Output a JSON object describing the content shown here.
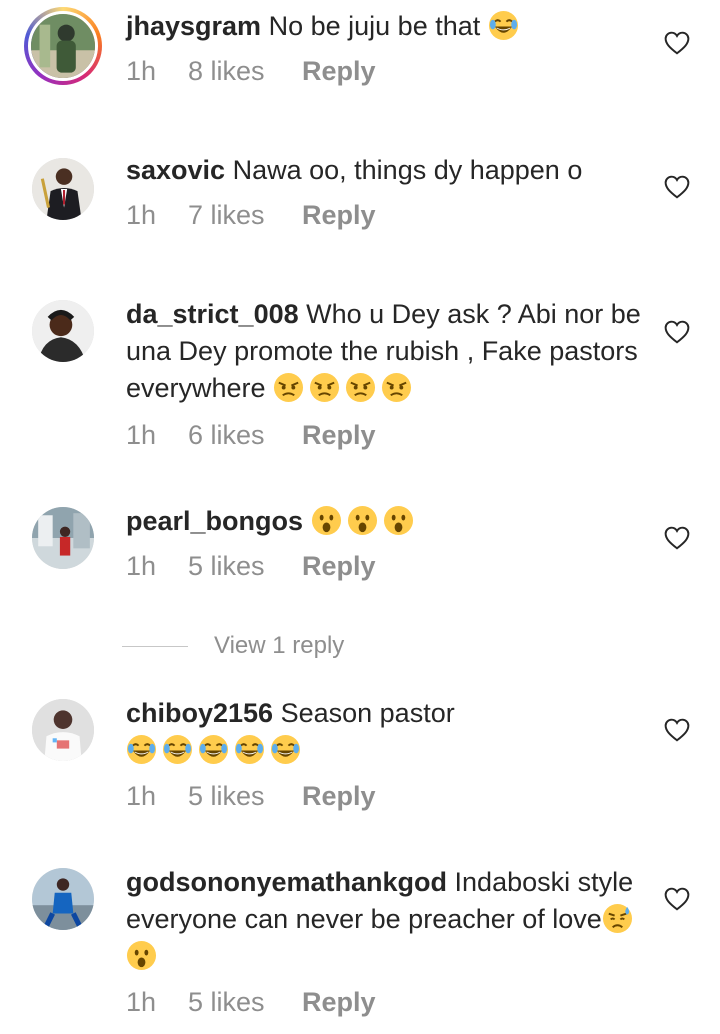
{
  "comments": [
    {
      "username": "jhaysgram",
      "text": "No be juju be that",
      "emojis": [
        "laughing"
      ],
      "time": "1h",
      "likes": "8 likes",
      "reply": "Reply",
      "avatar": "avatar-jhaysgram"
    },
    {
      "username": "saxovic",
      "text": "Nawa oo, things dy happen o",
      "emojis": [],
      "time": "1h",
      "likes": "7 likes",
      "reply": "Reply",
      "avatar": "avatar-saxovic"
    },
    {
      "username": "da_strict_008",
      "text": "Who u Dey ask ? Abi nor be una Dey promote the rubish , Fake pastors everywhere",
      "emojis": [
        "angry",
        "angry",
        "angry",
        "angry"
      ],
      "time": "1h",
      "likes": "6 likes",
      "reply": "Reply",
      "avatar": "avatar-da-strict"
    },
    {
      "username": "pearl_bongos",
      "text": "",
      "emojis": [
        "astonished",
        "astonished",
        "astonished"
      ],
      "time": "1h",
      "likes": "5 likes",
      "reply": "Reply",
      "avatar": "avatar-pearl"
    },
    {
      "username": "chiboy2156",
      "text": "Season pastor",
      "emojis": [
        "laughing",
        "laughing",
        "laughing",
        "laughing",
        "laughing"
      ],
      "time": "1h",
      "likes": "5 likes",
      "reply": "Reply",
      "avatar": "avatar-chiboy"
    },
    {
      "username": "godsononyemathankgod",
      "text": "Indaboski style everyone can never be preacher of love",
      "emojis": [
        "sad-sweat",
        "astonished"
      ],
      "time": "1h",
      "likes": "5 likes",
      "reply": "Reply",
      "avatar": "avatar-godson"
    }
  ],
  "view_replies": "View 1 reply",
  "colors": {
    "text": "#262626",
    "muted": "#8e8e8e",
    "emoji": "#ffcc4d"
  }
}
